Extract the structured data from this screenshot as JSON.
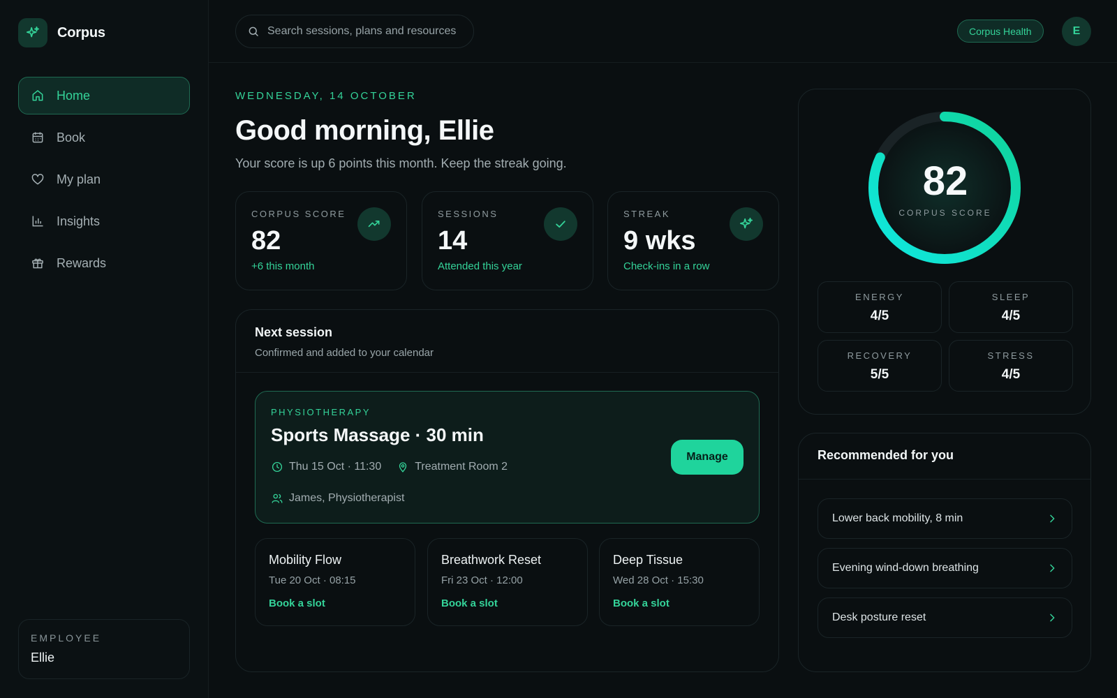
{
  "app": {
    "name": "Corpus"
  },
  "sidebar": {
    "items": [
      {
        "label": "Home",
        "icon": "home-icon",
        "active": true
      },
      {
        "label": "Book",
        "icon": "calendar-icon"
      },
      {
        "label": "My plan",
        "icon": "heart-icon"
      },
      {
        "label": "Insights",
        "icon": "bar-chart-icon"
      },
      {
        "label": "Rewards",
        "icon": "gift-icon"
      }
    ],
    "employee": {
      "label": "EMPLOYEE",
      "name": "Ellie"
    }
  },
  "header": {
    "search_placeholder": "Search sessions, plans and resources",
    "org_badge": "Corpus Health",
    "avatar_initial": "E"
  },
  "main": {
    "date": "WEDNESDAY, 14 OCTOBER",
    "greeting": "Good morning, Ellie",
    "subtitle": "Your score is up 6 points this month. Keep the streak going.",
    "stats": [
      {
        "label": "CORPUS SCORE",
        "value": "82",
        "note": "+6 this month",
        "icon": "trending-up-icon"
      },
      {
        "label": "SESSIONS",
        "value": "14",
        "note": "Attended this year",
        "icon": "check-icon"
      },
      {
        "label": "STREAK",
        "value": "9 wks",
        "note": "Check-ins in a row",
        "icon": "sparkle-icon"
      }
    ],
    "next_session": {
      "title": "Next session",
      "subtitle": "Confirmed and added to your calendar",
      "category": "PHYSIOTHERAPY",
      "name": "Sports Massage · 30 min",
      "when": "Thu 15 Oct · 11:30",
      "where": "Treatment Room 2",
      "who": "James, Physiotherapist",
      "manage_label": "Manage"
    },
    "upcoming": [
      {
        "title": "Mobility Flow",
        "time": "Tue 20 Oct · 08:15",
        "link": "Book a slot"
      },
      {
        "title": "Breathwork Reset",
        "time": "Fri 23 Oct · 12:00",
        "link": "Book a slot"
      },
      {
        "title": "Deep Tissue",
        "time": "Wed 28 Oct · 15:30",
        "link": "Book a slot"
      }
    ]
  },
  "score_panel": {
    "score": "82",
    "score_fraction": 0.82,
    "label": "CORPUS SCORE",
    "metrics": [
      {
        "label": "ENERGY",
        "value": "4/5"
      },
      {
        "label": "SLEEP",
        "value": "4/5"
      },
      {
        "label": "RECOVERY",
        "value": "5/5"
      },
      {
        "label": "STRESS",
        "value": "4/5"
      }
    ]
  },
  "recommended": {
    "title": "Recommended for you",
    "items": [
      {
        "label": "Lower back mobility, 8 min"
      },
      {
        "label": "Evening wind-down breathing"
      },
      {
        "label": "Desk posture reset"
      }
    ]
  },
  "colors": {
    "accent": "#34d399",
    "accent_strong": "#1fd49c",
    "background": "#0a0f11"
  }
}
